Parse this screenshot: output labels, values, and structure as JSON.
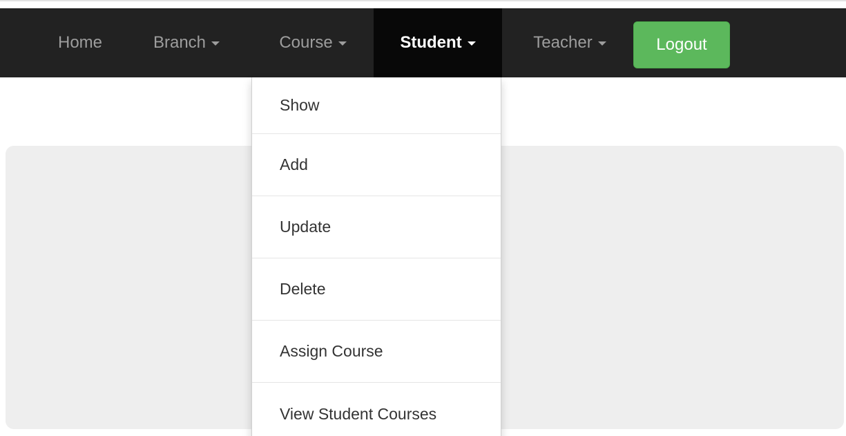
{
  "navbar": {
    "items": [
      {
        "label": "Home",
        "has_caret": false
      },
      {
        "label": "Branch",
        "has_caret": true
      },
      {
        "label": "Course",
        "has_caret": true
      },
      {
        "label": "Student",
        "has_caret": true,
        "active": true
      },
      {
        "label": "Teacher",
        "has_caret": true
      }
    ],
    "logout_label": "Logout"
  },
  "dropdown": {
    "items": [
      {
        "label": "Show"
      },
      {
        "label": "Add"
      },
      {
        "label": "Update"
      },
      {
        "label": "Delete"
      },
      {
        "label": "Assign Course"
      },
      {
        "label": "View Student Courses"
      }
    ]
  },
  "colors": {
    "navbar_bg": "#222222",
    "navbar_active_bg": "#080808",
    "logout_bg": "#5cb85c",
    "jumbotron_bg": "#eeeeee"
  }
}
